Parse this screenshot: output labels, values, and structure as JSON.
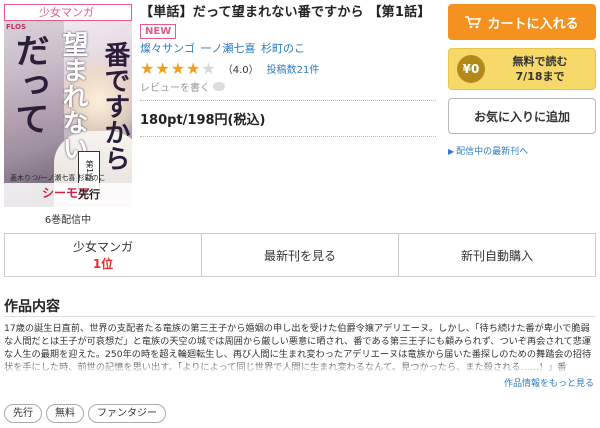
{
  "cover": {
    "genre_badge": "少女マンガ",
    "label": "FLOS",
    "title_line1": "だって望まれない",
    "title_line2": "番ですから",
    "volume_label": "第1話",
    "cover_author": "菱木りつ/一ノ瀬七喜 杉町のこ",
    "logo": "シーモア",
    "senkou": "先行",
    "distribution_note": "6巻配信中"
  },
  "info": {
    "title": "【単話】だって望まれない番ですから 【第1話】",
    "new_badge": "NEW",
    "authors": [
      "燦々サンゴ",
      "一ノ瀬七喜",
      "杉町のこ"
    ],
    "rating": 4.0,
    "rating_text": "（4.0）",
    "post_count": "投稿数21件",
    "review_link": "レビューを書く",
    "price": "180pt/198円(税込)"
  },
  "actions": {
    "cart_label": "カートに入れる",
    "free_line1": "無料で読む",
    "free_line2": "7/18まで",
    "free_badge": "¥0",
    "favorite_label": "お気に入りに追加",
    "notify_link": "配信中の最新刊へ"
  },
  "tabs": [
    {
      "label": "少女マンガ",
      "sub": "1位"
    },
    {
      "label": "最新刊を見る",
      "sub": ""
    },
    {
      "label": "新刊自動購入",
      "sub": ""
    }
  ],
  "description": {
    "heading": "作品内容",
    "text": "17歳の誕生日直前、世界の支配者たる竜族の第三王子から婚姻の申し出を受けた伯爵令嬢アデリエーヌ。しかし、「待ち続けた番が卑小で脆弱な人間だとは王子が可哀想だ」と竜族の天空の城では周囲から厳しい悪意に晒され、番である第三王子にも顧みられず、ついぞ再会されて悲運な人生の最期を迎えた。250年の時を超え輪廻転生し、再び人間に生まれ変わったアデリエーヌは竜族から届いた番探しのための舞踏会の招待状を手にした時、前世の記憶を思い出す。「よりによって同じ世界で人間に生まれ変わるなんて。見つかったら、また殺される……！」番",
    "more_link": "作品情報をもっと見る"
  },
  "tags": [
    "先行",
    "無料",
    "ファンタジー"
  ]
}
